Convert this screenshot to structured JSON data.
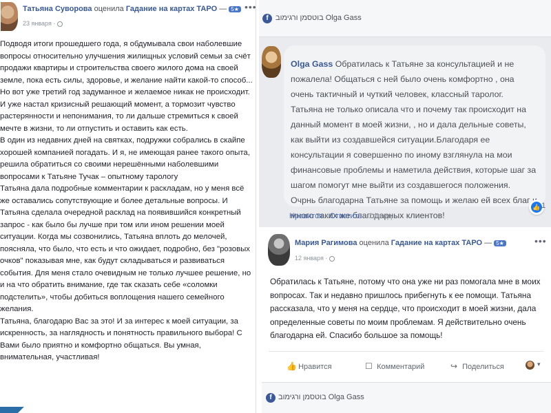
{
  "left_post": {
    "author": "Татьяна Суворова",
    "action": "оценила",
    "page": "Гадание на картах ТАРО",
    "page_suffix": " —",
    "badge": "5★",
    "date": "23 января ·",
    "paragraphs": [
      "Подводя итоги прошедшего года, я обдумывала свои наболевшие вопросы относительно улучшения жилищных условий семьи за счёт продажи квартиры и строительства своего жилого дома на своей земле, пока есть силы, здоровье, и желание найти какой-то способ...",
      "Но вот уже третий год задуманное и желаемое никак не происходит. И уже настал кризисный решающий момент, а тормозит чувство растерянности и непонимания, то ли дальше стремиться к своей мечте в жизни, то ли отпустить и оставить как есть.",
      "В один из недавних дней на святках, подружки собрались в скайпе хорошей компанией погадать. И я, не имеющая ранее такого опыта, решила обратиться со своими нерешёнными наболевшими вопросами к Татьяне Тучак – опытному тарологу",
      "Татьяна дала подробные комментарии к раскладам, но у меня всё же оставались сопутствующие и более детальные вопросы. И Татьяна сделала очередной расклад на появившийся конкретный запрос - как было бы лучше при том или ином решении моей ситуации. Когда мы созвонились, Татьяна вплоть до мелочей, поясняла, что было, что есть и что ожидает, подробно, без \"розовых очков\" показывая мне, как будут складываться и развиваться события. Для меня стало очевидным не только лучшее решение, но и на что обратить внимание, где так сказать себе «соломки подстелить», чтобы добиться воплощения нашего семейного желания.",
      "Татьяна, благодарю Вас за это! И за интерес к моей ситуации, за искренность, за наглядность и понятность правильного выбора! С Вами было приятно и комфортно общаться. Вы умная, внимательная, участливая!"
    ]
  },
  "top_right": {
    "bar_text": "בוטסמן ורגימוב Olga Gass",
    "comment_author": "Olga Gass",
    "comment_text": "Обратилась к Татьяне за консультацией и не пожалела! Общаться с ней было очень комфортно , она очень тактичный и чуткий человек, классный таролог. Татьяна не только описала что и почему так происходит на данный момент в моей жизни, , но и дала дельные советы, как выйти из создавшейся ситуации.Благодаря ее консультации я совершенно по иному взглянула на мои финансовые проблемы и наметила действия, которые шаг за шагом помогут мне выйти из создавшегося положения. Очрнь благодарна Татьяне за помощь и желаю ей всех благ и много таких же благодарных клиентов!",
    "like_count": "1",
    "actions": {
      "like": "Нравится",
      "sep": " · ",
      "reply": "Ответить",
      "time": "14 нед."
    }
  },
  "bottom_right": {
    "author": "Мария Рагимова",
    "action": "оценила",
    "page": "Гадание на картах ТАРО",
    "page_suffix": " —",
    "badge": "5★",
    "date": "12 января ·",
    "body": "Обратилась к Татьяне, потому что она уже ни раз помогала мне в моих вопросах. Так и недавно пришлось прибегнуть к ее помощи. Татьяна рассказала, что у меня на сердце, что происходит в моей жизни, дала определенные советы по моим проблемам. Я действительно очень благодарна ей. Спасибо большое за помощь!",
    "actions": {
      "like": "Нравится",
      "comment": "Комментарий",
      "share": "Поделиться"
    },
    "footer_text": "בוטסמן ורגימוב Olga Gass"
  },
  "icons": {
    "more": "more-dots-icon",
    "like": "thumbs-up-icon",
    "comment": "speech-bubble-icon",
    "share": "share-arrow-icon",
    "globe": "globe-icon",
    "facebook": "facebook-icon"
  },
  "colors": {
    "link": "#385898",
    "accent": "#1877f2",
    "badge": "#4a76c7"
  }
}
